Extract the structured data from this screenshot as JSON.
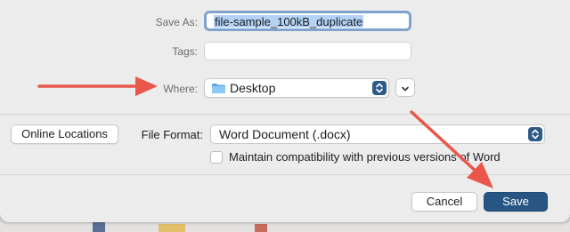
{
  "dialog": {
    "save_as_label": "Save As:",
    "filename": "file-sample_100kB_duplicate",
    "tags_label": "Tags:",
    "tags_value": "",
    "where_label": "Where:",
    "where_value": "Desktop",
    "online_locations_label": "Online Locations",
    "file_format_label": "File Format:",
    "file_format_value": "Word Document (.docx)",
    "compat_label": "Maintain compatibility with previous versions of Word",
    "compat_checked": false,
    "cancel_label": "Cancel",
    "save_label": "Save"
  },
  "icons": {
    "folder": "folder-icon",
    "stepper": "up-down-chevron-icon",
    "expand": "chevron-down-icon",
    "annotation": "red-arrow"
  },
  "colors": {
    "accent": "#275684",
    "focus_ring": "#7fa3cb",
    "selection": "#b3d2f6",
    "annotation_arrow": "#e9574a",
    "dialog_bg": "#ececec"
  }
}
